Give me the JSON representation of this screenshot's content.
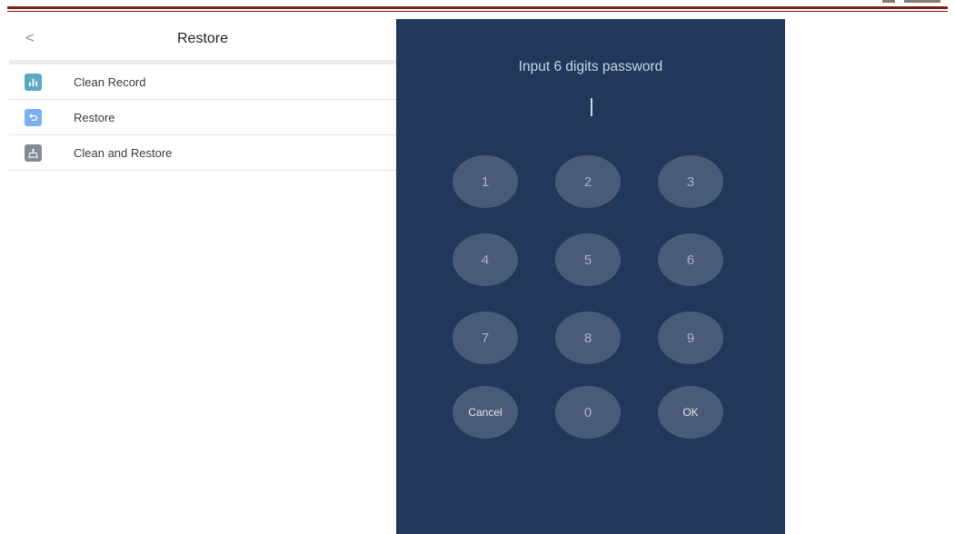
{
  "left_panel": {
    "back_glyph": "<",
    "title": "Restore",
    "items": [
      {
        "label": "Clean Record",
        "icon": "clean-record-icon",
        "color": "#5ba8c0"
      },
      {
        "label": "Restore",
        "icon": "undo-arrow-icon",
        "color": "#7ab0ee"
      },
      {
        "label": "Clean and Restore",
        "icon": "broom-icon",
        "color": "#848c99"
      }
    ]
  },
  "keypad": {
    "prompt": "Input 6 digits password",
    "keys": [
      "1",
      "2",
      "3",
      "4",
      "5",
      "6",
      "7",
      "8",
      "9",
      "Cancel",
      "0",
      "OK"
    ]
  },
  "colors": {
    "keypad_background": "#22385a",
    "key_background": "#4a5b77",
    "header_rule": "#7a1f14"
  }
}
